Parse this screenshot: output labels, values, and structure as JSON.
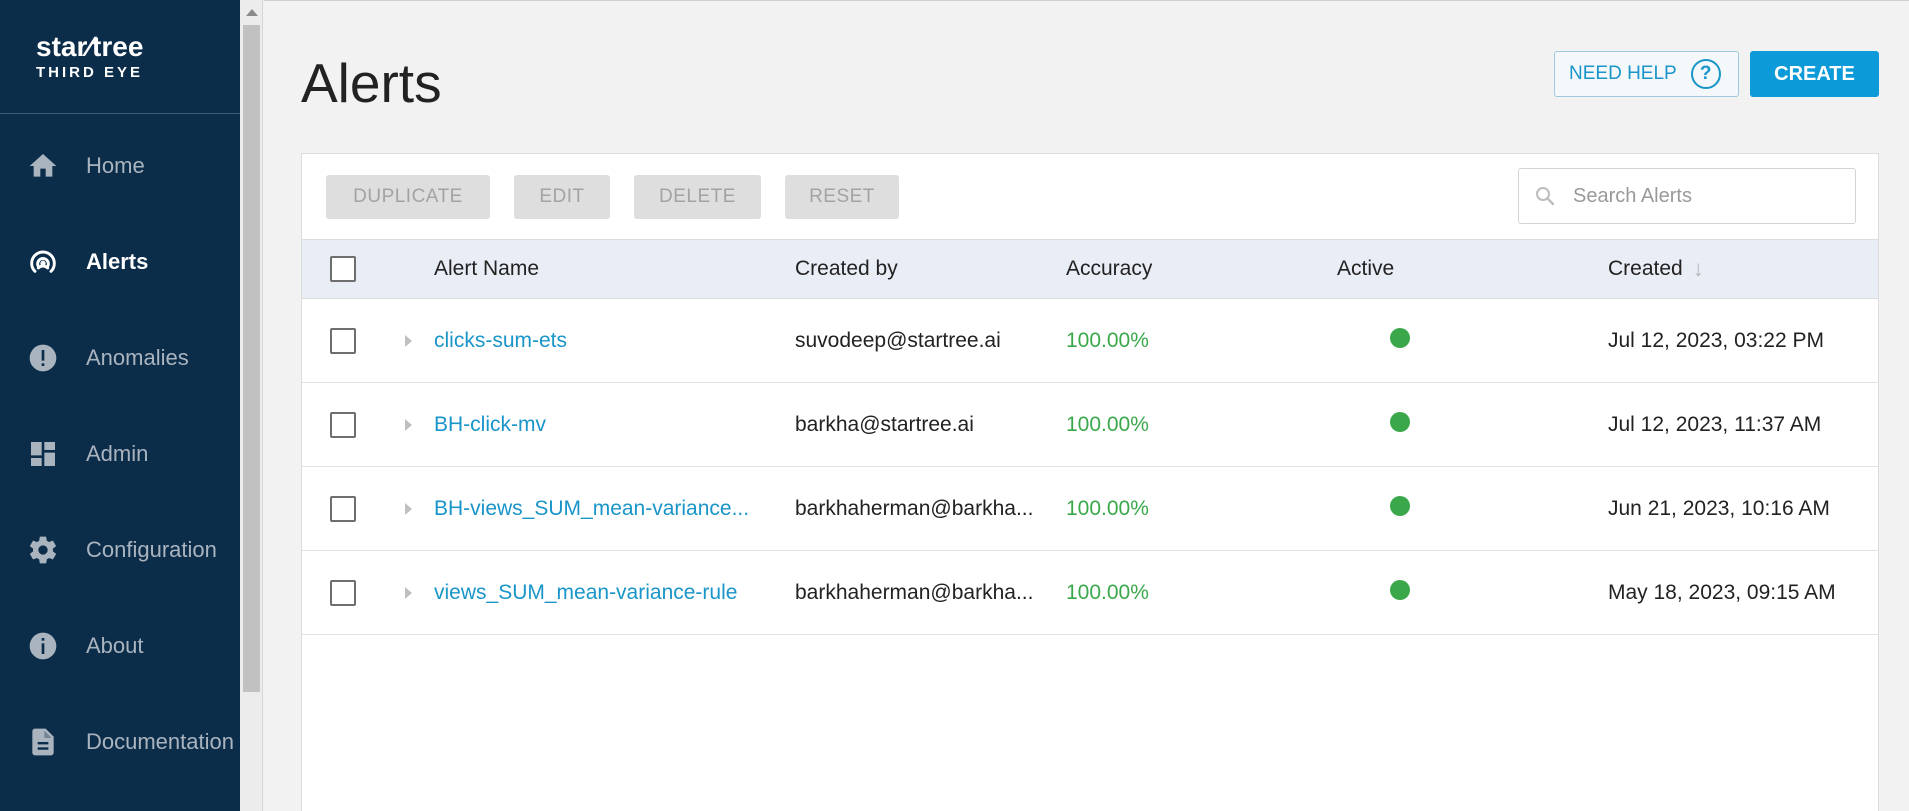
{
  "brand": {
    "name": "star∕tree",
    "sub": "THIRD EYE"
  },
  "sidebar": {
    "items": [
      {
        "label": "Home",
        "icon": "home-icon",
        "active": false
      },
      {
        "label": "Alerts",
        "icon": "alerts-icon",
        "active": true
      },
      {
        "label": "Anomalies",
        "icon": "anomalies-icon",
        "active": false
      },
      {
        "label": "Admin",
        "icon": "admin-icon",
        "active": false
      },
      {
        "label": "Configuration",
        "icon": "gear-icon",
        "active": false
      },
      {
        "label": "About",
        "icon": "info-icon",
        "active": false
      },
      {
        "label": "Documentation",
        "icon": "document-icon",
        "active": false
      }
    ]
  },
  "header": {
    "title": "Alerts",
    "help_label": "NEED HELP",
    "help_icon": "?",
    "create_label": "CREATE"
  },
  "toolbar": {
    "duplicate_label": "DUPLICATE",
    "edit_label": "EDIT",
    "delete_label": "DELETE",
    "reset_label": "RESET",
    "search_placeholder": "Search Alerts"
  },
  "table": {
    "columns": {
      "name": "Alert Name",
      "created_by": "Created by",
      "accuracy": "Accuracy",
      "active": "Active",
      "created": "Created"
    },
    "rows": [
      {
        "name": "clicks-sum-ets",
        "created_by": "suvodeep@startree.ai",
        "accuracy": "100.00%",
        "active": true,
        "created": "Jul 12, 2023, 03:22 PM"
      },
      {
        "name": "BH-click-mv",
        "created_by": "barkha@startree.ai",
        "accuracy": "100.00%",
        "active": true,
        "created": "Jul 12, 2023, 11:37 AM"
      },
      {
        "name": "BH-views_SUM_mean-variance...",
        "created_by": "barkhaherman@barkha...",
        "accuracy": "100.00%",
        "active": true,
        "created": "Jun 21, 2023, 10:16 AM"
      },
      {
        "name": "views_SUM_mean-variance-rule",
        "created_by": "barkhaherman@barkha...",
        "accuracy": "100.00%",
        "active": true,
        "created": "May 18, 2023, 09:15 AM"
      }
    ]
  },
  "colors": {
    "sidebar_bg": "#0c2d49",
    "accent": "#0c9ad8",
    "link": "#1995c9",
    "success": "#3aa84a"
  }
}
